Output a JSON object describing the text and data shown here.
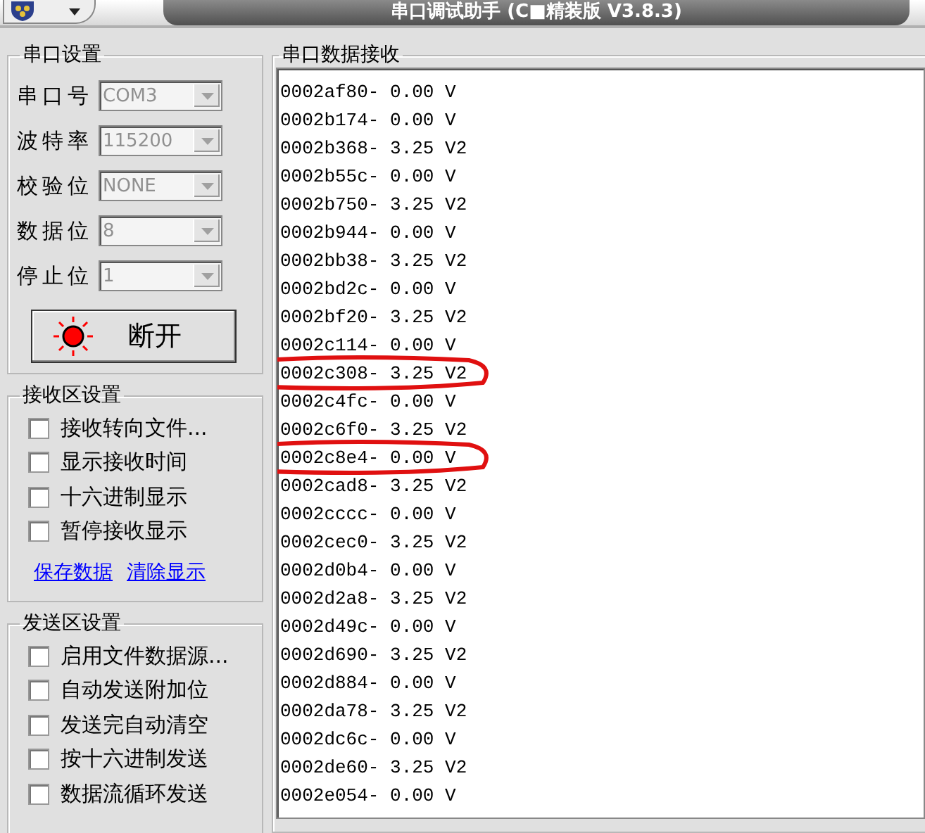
{
  "window": {
    "title": "串口调试助手 (C■精装版 V3.8.3)"
  },
  "port_settings": {
    "title": "串口设置",
    "fields": [
      {
        "label": "串口号",
        "value": "COM3",
        "disabled": true
      },
      {
        "label": "波特率",
        "value": "115200",
        "disabled": true
      },
      {
        "label": "校验位",
        "value": "NONE",
        "disabled": true
      },
      {
        "label": "数据位",
        "value": "8",
        "disabled": true
      },
      {
        "label": "停止位",
        "value": "1",
        "disabled": true
      }
    ],
    "connect_button": {
      "label": "断开",
      "on": true
    }
  },
  "receive_settings": {
    "title": "接收区设置",
    "options": [
      {
        "label": "接收转向文件...",
        "checked": false
      },
      {
        "label": "显示接收时间",
        "checked": false
      },
      {
        "label": "十六进制显示",
        "checked": false
      },
      {
        "label": "暂停接收显示",
        "checked": false
      }
    ],
    "links": [
      "保存数据",
      "清除显示"
    ]
  },
  "send_settings": {
    "title": "发送区设置",
    "options": [
      {
        "label": "启用文件数据源...",
        "checked": false
      },
      {
        "label": "自动发送附加位",
        "checked": false
      },
      {
        "label": "发送完自动清空",
        "checked": false
      },
      {
        "label": "按十六进制发送",
        "checked": false
      },
      {
        "label": "数据流循环发送",
        "checked": false
      }
    ]
  },
  "receive_area": {
    "title": "串口数据接收",
    "rows": [
      {
        "text": "0002af80- 0.00 V",
        "circled": false
      },
      {
        "text": "0002b174- 0.00 V",
        "circled": false
      },
      {
        "text": "0002b368- 3.25 V2",
        "circled": false
      },
      {
        "text": "0002b55c- 0.00 V",
        "circled": false
      },
      {
        "text": "0002b750- 3.25 V2",
        "circled": false
      },
      {
        "text": "0002b944- 0.00 V",
        "circled": false
      },
      {
        "text": "0002bb38- 3.25 V2",
        "circled": false
      },
      {
        "text": "0002bd2c- 0.00 V",
        "circled": false
      },
      {
        "text": "0002bf20- 3.25 V2",
        "circled": false
      },
      {
        "text": "0002c114- 0.00 V",
        "circled": false
      },
      {
        "text": "0002c308- 3.25 V2",
        "circled": true
      },
      {
        "text": "0002c4fc- 0.00 V",
        "circled": false
      },
      {
        "text": "0002c6f0- 3.25 V2",
        "circled": false
      },
      {
        "text": "0002c8e4- 0.00 V",
        "circled": true
      },
      {
        "text": "0002cad8- 3.25 V2",
        "circled": false
      },
      {
        "text": "0002cccc- 0.00 V",
        "circled": false
      },
      {
        "text": "0002cec0- 3.25 V2",
        "circled": false
      },
      {
        "text": "0002d0b4- 0.00 V",
        "circled": false
      },
      {
        "text": "0002d2a8- 3.25 V2",
        "circled": false
      },
      {
        "text": "0002d49c- 0.00 V",
        "circled": false
      },
      {
        "text": "0002d690- 3.25 V2",
        "circled": false
      },
      {
        "text": "0002d884- 0.00 V",
        "circled": false
      },
      {
        "text": "0002da78- 3.25 V2",
        "circled": false
      },
      {
        "text": "0002dc6c- 0.00 V",
        "circled": false
      },
      {
        "text": "0002de60- 3.25 V2",
        "circled": false
      },
      {
        "text": "0002e054- 0.00 V",
        "circled": false
      }
    ]
  }
}
